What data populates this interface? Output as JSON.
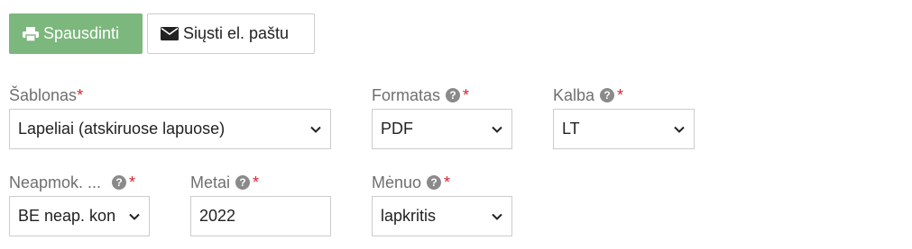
{
  "actions": {
    "print_label": "Spausdinti",
    "email_label": "Siųsti el. paštu"
  },
  "form": {
    "template": {
      "label": "Šablonas",
      "required_mark": "*",
      "value": "Lapeliai (atskiruose lapuose)"
    },
    "format": {
      "label": "Formatas",
      "help_mark": "?",
      "required_mark": "*",
      "value": "PDF"
    },
    "language": {
      "label": "Kalba",
      "help_mark": "?",
      "required_mark": "*",
      "value": "LT"
    },
    "unpaid": {
      "label": "Neapmok. ...",
      "help_mark": "?",
      "required_mark": "*",
      "value": "BE neap. kon"
    },
    "year": {
      "label": "Metai",
      "help_mark": "?",
      "required_mark": "*",
      "value": "2022"
    },
    "month": {
      "label": "Mėnuo",
      "help_mark": "?",
      "required_mark": "*",
      "value": "lapkritis"
    }
  },
  "colors": {
    "print_button_bg": "#7cb77d",
    "required_mark": "#d9232d",
    "label_text": "#6f6f6f"
  },
  "icons": {
    "print": "printer-icon",
    "email": "envelope-icon",
    "help": "question-circle-icon",
    "dropdown": "chevron-down-icon"
  }
}
